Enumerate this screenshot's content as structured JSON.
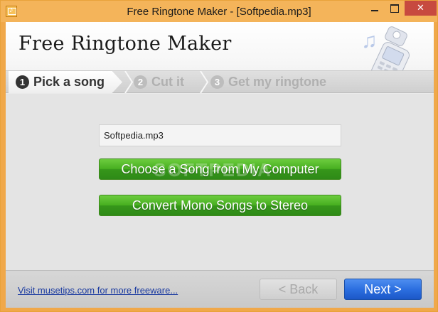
{
  "window": {
    "title": "Free Ringtone Maker - [Softpedia.mp3]",
    "accent_color": "#f4b45a"
  },
  "header": {
    "app_title": "Free Ringtone Maker",
    "icons": [
      "music-note-icon",
      "cell-phone-icon"
    ]
  },
  "steps": [
    {
      "number": "1",
      "label": "Pick a song",
      "active": true
    },
    {
      "number": "2",
      "label": "Cut it",
      "active": false
    },
    {
      "number": "3",
      "label": "Get my ringtone",
      "active": false
    }
  ],
  "main": {
    "file_field_value": "Softpedia.mp3",
    "choose_song_label": "Choose a Song from My Computer",
    "convert_label": "Convert Mono Songs to Stereo",
    "watermark": "SOFTPEDIA",
    "button_color": "#48b021"
  },
  "footer": {
    "link_text": "Visit musetips.com for more freeware...",
    "back_label": "< Back",
    "next_label": "Next >",
    "next_color": "#2c6fe0"
  }
}
